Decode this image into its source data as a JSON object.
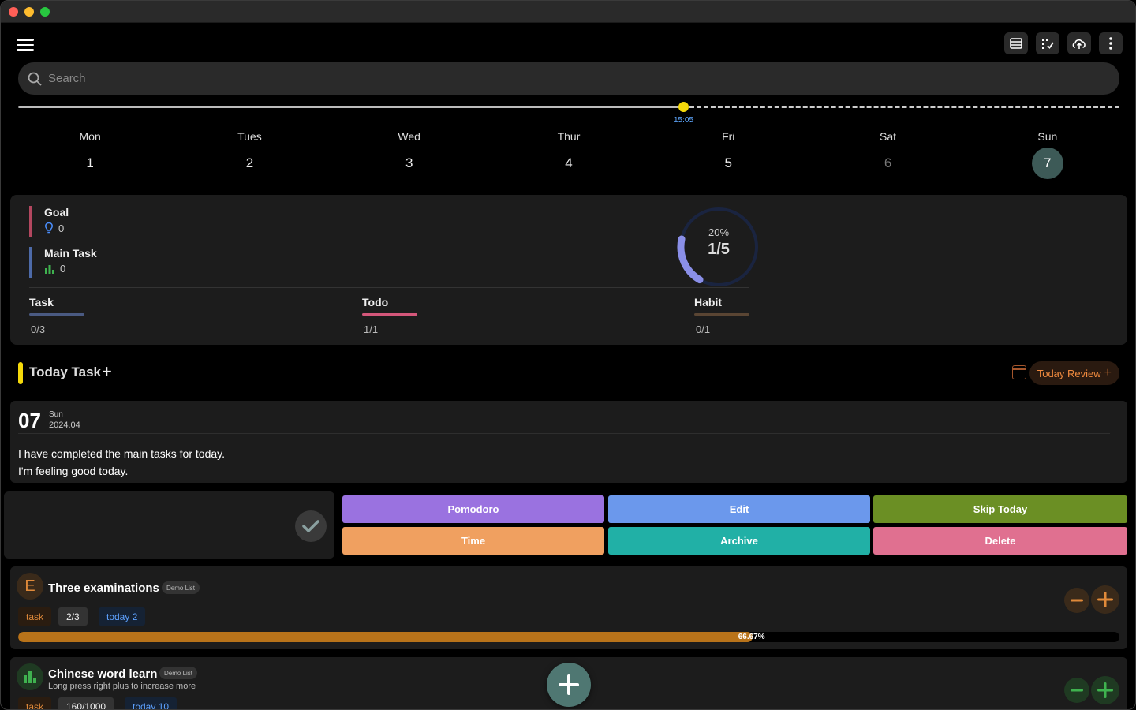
{
  "search": {
    "placeholder": "Search"
  },
  "timeline": {
    "current_time": "15:05",
    "progress": 0.604
  },
  "week": [
    {
      "name": "Mon",
      "num": "1",
      "state": "normal"
    },
    {
      "name": "Tues",
      "num": "2",
      "state": "normal"
    },
    {
      "name": "Wed",
      "num": "3",
      "state": "normal"
    },
    {
      "name": "Thur",
      "num": "4",
      "state": "normal"
    },
    {
      "name": "Fri",
      "num": "5",
      "state": "normal"
    },
    {
      "name": "Sat",
      "num": "6",
      "state": "dim"
    },
    {
      "name": "Sun",
      "num": "7",
      "state": "active"
    }
  ],
  "stats": {
    "goal": {
      "label": "Goal",
      "value": "0",
      "color": "#b3475f",
      "icon": "lightbulb-icon"
    },
    "main_task": {
      "label": "Main Task",
      "value": "0",
      "color": "#4d6aa8",
      "icon": "bar-chart-icon"
    },
    "ring": {
      "percent": "20%",
      "fraction": "1/5",
      "progress": 0.2,
      "color": "#8a8fe8"
    },
    "categories": [
      {
        "label": "Task",
        "value": "0/3",
        "color": "#4a5a82"
      },
      {
        "label": "Todo",
        "value": "1/1",
        "color": "#d4577a"
      },
      {
        "label": "Habit",
        "value": "0/1",
        "color": "#5a4533"
      }
    ]
  },
  "today_task": {
    "title": "Today Task",
    "review_label": "Today Review"
  },
  "review": {
    "day": "07",
    "weekday": "Sun",
    "year_month": "2024.04",
    "line1": "I have completed the main tasks for today.",
    "line2": "I'm feeling good today."
  },
  "actions": [
    {
      "label": "Pomodoro",
      "color": "#9a72e0"
    },
    {
      "label": "Edit",
      "color": "#6b98ec"
    },
    {
      "label": "Skip Today",
      "color": "#6b8f24"
    },
    {
      "label": "Time",
      "color": "#f0a060"
    },
    {
      "label": "Archive",
      "color": "#21b0a6"
    },
    {
      "label": "Delete",
      "color": "#e07090"
    }
  ],
  "tasks": [
    {
      "avatar": "E",
      "title": "Three examinations",
      "tag": "Demo List",
      "chip_task": "task",
      "chip_count": "2/3",
      "chip_today": "today 2",
      "progress": 0.6667,
      "progress_label": "66.67%"
    },
    {
      "avatar": "bar-chart-icon",
      "title": "Chinese word learn",
      "tag": "Demo List",
      "subtitle": "Long press right plus to increase more",
      "chip_task": "task",
      "chip_count": "160/1000",
      "chip_today": "today 10"
    }
  ]
}
